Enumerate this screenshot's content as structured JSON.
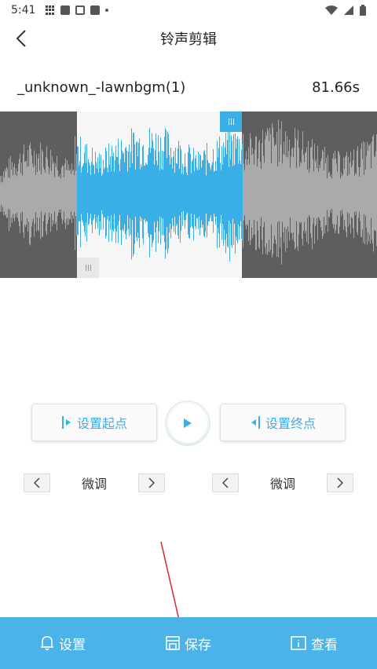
{
  "status_bar": {
    "time": "5:41",
    "icons": [
      "grid-icon",
      "a-icon",
      "box-icon",
      "square-icon",
      "dot-icon"
    ],
    "right_icons": [
      "wifi-icon",
      "signal-icon",
      "battery-icon"
    ]
  },
  "header": {
    "title": "铃声剪辑",
    "back_icon": "chevron-left-icon"
  },
  "file": {
    "name": "_unknown_-lawnbgm(1)",
    "duration": "81.66s"
  },
  "waveform": {
    "selection_start_fraction": 0.204,
    "selection_end_fraction": 0.642,
    "colors": {
      "background": "#5e5e5e",
      "selection_bg": "#f6f6f6",
      "selected_wave": "#3aaee6",
      "unselected_wave": "#aaaaaa"
    }
  },
  "controls": {
    "set_start_label": "设置起点",
    "set_end_label": "设置终点",
    "play_icon": "play-icon"
  },
  "fine_tune": {
    "left_label": "微调",
    "right_label": "微调"
  },
  "bottom_nav": {
    "settings_label": "设置",
    "save_label": "保存",
    "view_label": "查看"
  },
  "colors": {
    "accent": "#3aaee6",
    "bottom_bar": "#4cb3e8",
    "annotation_arrow": "#d9262b"
  }
}
